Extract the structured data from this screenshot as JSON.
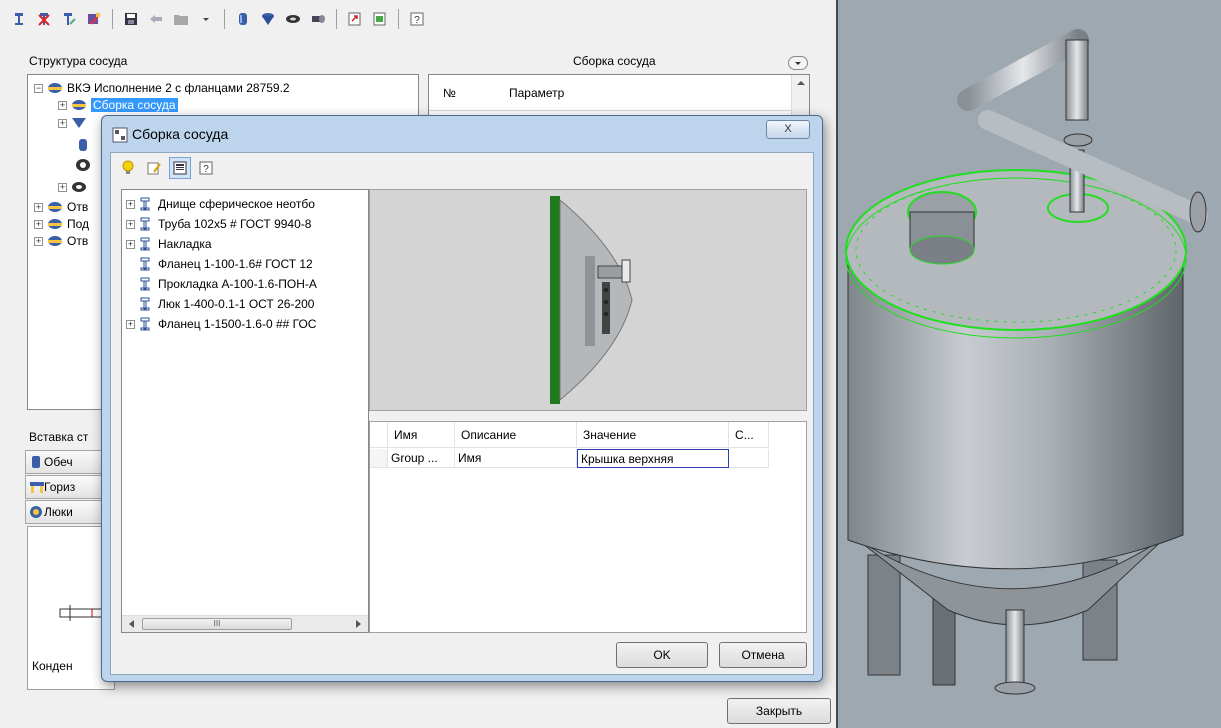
{
  "colors": {
    "selection": "#3399ff",
    "dialog_frame": "#bcd4ec",
    "model_background": "#9ea8b0",
    "flange_highlight": "#22dd22"
  },
  "toolbar_icons": [
    "valve-icon",
    "delete-valve-icon",
    "edit-valve-icon",
    "valve-tool-icon",
    "save-icon",
    "back-arrow-icon",
    "folder-icon",
    "dropdown-icon",
    "vessel-icon",
    "cone-icon",
    "gasket-icon",
    "pipe-icon",
    "export-icon",
    "report-icon",
    "help-icon"
  ],
  "structure": {
    "label": "Структура сосуда",
    "root": "ВКЭ Исполнение 2 с фланцами 28759.2",
    "selected": "Сборка сосуда",
    "truncated": [
      "Отв",
      "Под",
      "Отв"
    ]
  },
  "params": {
    "label": "Сборка сосуда",
    "col_no": "№",
    "col_param": "Параметр"
  },
  "insert": {
    "label": "Вставка ст",
    "tabs": [
      "Обеч",
      "Гориз",
      "Люки"
    ],
    "bottom_label": "Конден"
  },
  "close_button": "Закрыть",
  "dialog": {
    "title": "Сборка сосуда",
    "close_glyph": "X",
    "toolbar_icons": [
      "bulb-icon",
      "edit-icon",
      "panel-icon",
      "help-icon"
    ],
    "tree": [
      {
        "label": "Днище сферическое неотбо",
        "expand": "+"
      },
      {
        "label": "Труба 102х5 # ГОСТ 9940-8",
        "expand": "+"
      },
      {
        "label": "Накладка",
        "expand": "+"
      },
      {
        "label": "Фланец 1-100-1.6# ГОСТ 12",
        "expand": ""
      },
      {
        "label": "Прокладка А-100-1.6-ПОН-А",
        "expand": ""
      },
      {
        "label": "Люк 1-400-0.1-1 ОСТ 26-200",
        "expand": ""
      },
      {
        "label": "Фланец 1-1500-1.6-0 ## ГОС",
        "expand": "+"
      }
    ],
    "scroll_thumb": "III",
    "grid": {
      "headers": [
        "Имя",
        "Описание",
        "Значение",
        "С..."
      ],
      "row": [
        "Group ...",
        "Имя",
        "Крышка верхняя"
      ]
    },
    "ok": "OK",
    "cancel": "Отмена"
  }
}
